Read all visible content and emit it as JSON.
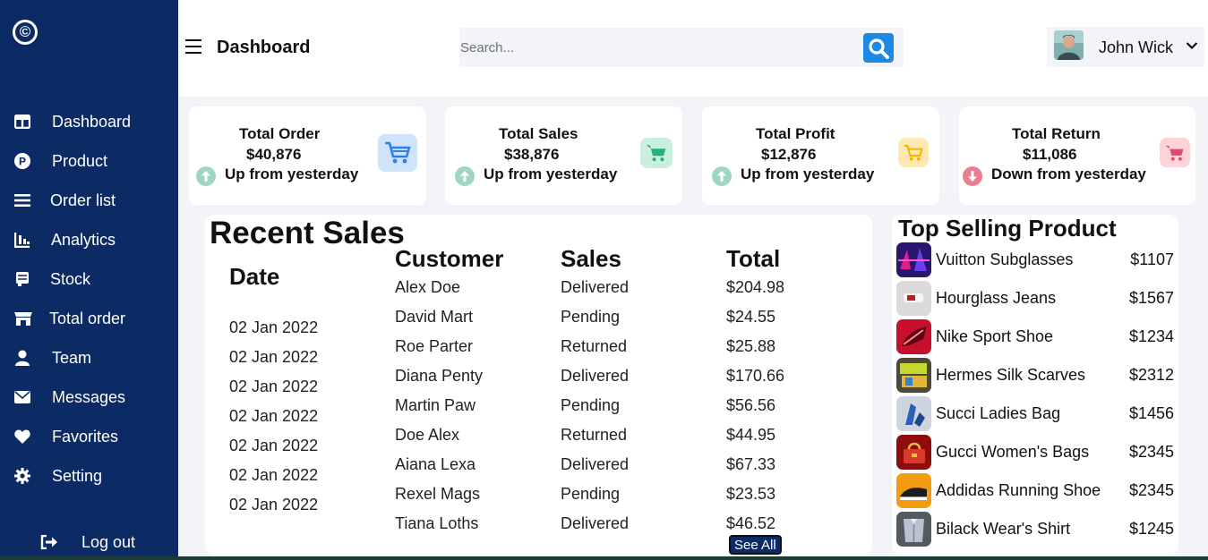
{
  "sidebar": {
    "logo": "©",
    "items": [
      {
        "label": "Dashboard",
        "icon": "dashboard-icon"
      },
      {
        "label": "Product",
        "icon": "product-icon"
      },
      {
        "label": "Order list",
        "icon": "list-icon"
      },
      {
        "label": "Analytics",
        "icon": "analytics-icon"
      },
      {
        "label": "Stock",
        "icon": "stock-icon"
      },
      {
        "label": "Total order",
        "icon": "store-icon"
      },
      {
        "label": "Team",
        "icon": "user-icon"
      },
      {
        "label": "Messages",
        "icon": "envelope-icon"
      },
      {
        "label": "Favorites",
        "icon": "heart-icon"
      },
      {
        "label": "Setting",
        "icon": "gear-icon"
      }
    ],
    "logout_label": "Log out"
  },
  "header": {
    "title": "Dashboard",
    "search_placeholder": "Search...",
    "user_name": "John Wick"
  },
  "stats": [
    {
      "title": "Total Order",
      "value": "$40,876",
      "trend": "Up from yesterday",
      "direction": "up",
      "accent": "#2f80ed",
      "accent_bg": "#cfe4fb"
    },
    {
      "title": "Total Sales",
      "value": "$38,876",
      "trend": "Up from yesterday",
      "direction": "up",
      "accent": "#22b27a",
      "accent_bg": "#c8f0dc"
    },
    {
      "title": "Total Profit",
      "value": "$12,876",
      "trend": "Up from yesterday",
      "direction": "up",
      "accent": "#f2b705",
      "accent_bg": "#fde9b3"
    },
    {
      "title": "Total Return",
      "value": "$11,086",
      "trend": "Down from yesterday",
      "direction": "down",
      "accent": "#e04a6a",
      "accent_bg": "#fbd3d9"
    }
  ],
  "recent_sales": {
    "title": "Recent Sales",
    "columns": [
      "Date",
      "Customer",
      "Sales",
      "Total"
    ],
    "dates": [
      "02 Jan 2022",
      "02 Jan 2022",
      "02 Jan 2022",
      "02 Jan 2022",
      "02 Jan 2022",
      "02 Jan 2022",
      "02 Jan 2022"
    ],
    "customers": [
      "Alex Doe",
      "David Mart",
      "Roe Parter",
      "Diana Penty",
      "Martin Paw",
      "Doe Alex",
      "Aiana Lexa",
      "Rexel Mags",
      "Tiana Loths"
    ],
    "sales": [
      "Delivered",
      "Pending",
      "Returned",
      "Delivered",
      "Pending",
      "Returned",
      "Delivered",
      "Pending",
      "Delivered"
    ],
    "totals": [
      "$204.98",
      "$24.55",
      "$25.88",
      "$170.66",
      "$56.56",
      "$44.95",
      "$67.33",
      "$23.53",
      "$46.52"
    ],
    "see_all_label": "See All"
  },
  "top_selling": {
    "title": "Top Selling Product",
    "products": [
      {
        "name": "Vuitton Subglasses",
        "price": "$1107",
        "thumb_color": "#3a1b8c"
      },
      {
        "name": "Hourglass Jeans",
        "price": "$1567",
        "thumb_color": "#d8d6d6"
      },
      {
        "name": "Nike Sport Shoe",
        "price": "$1234",
        "thumb_color": "#c8102e"
      },
      {
        "name": "Hermes Silk Scarves",
        "price": "$2312",
        "thumb_color": "#7a8f2a"
      },
      {
        "name": "Succi Ladies Bag",
        "price": "$1456",
        "thumb_color": "#c5ccd8"
      },
      {
        "name": "Gucci Women's Bags",
        "price": "$2345",
        "thumb_color": "#9e1010"
      },
      {
        "name": "Addidas Running Shoe",
        "price": "$2345",
        "thumb_color": "#f39c12"
      },
      {
        "name": "Bilack Wear's Shirt",
        "price": "$1245",
        "thumb_color": "#555a60"
      }
    ]
  }
}
